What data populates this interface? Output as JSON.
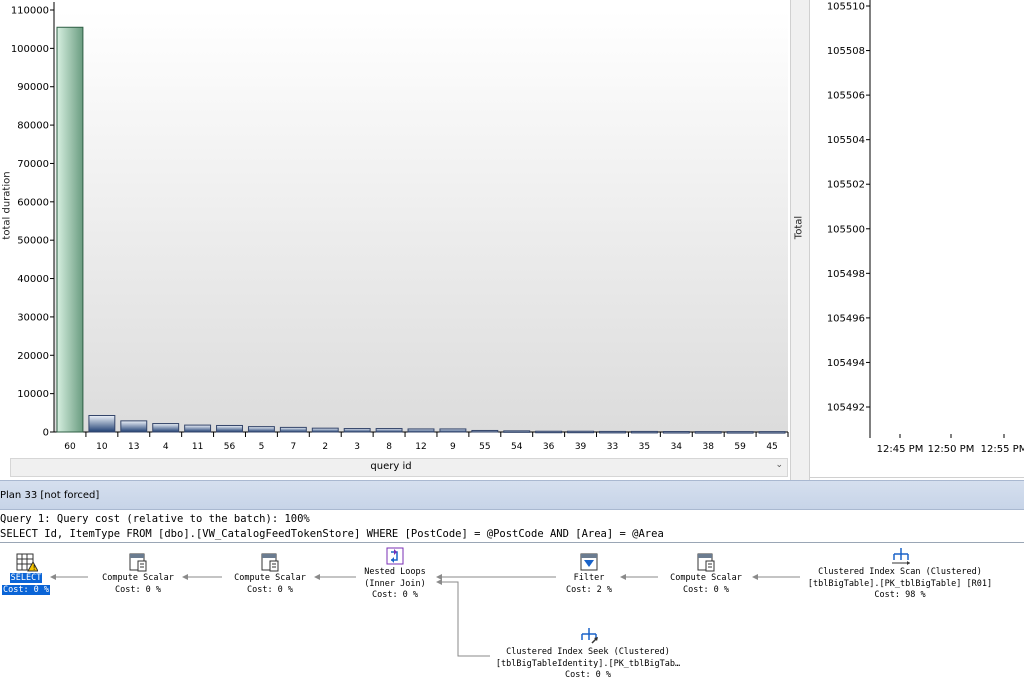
{
  "left_chart": {
    "ylabel": "total duration",
    "xlabel": "query id",
    "y_ticks": [
      "0",
      "10000",
      "20000",
      "30000",
      "40000",
      "50000",
      "60000",
      "70000",
      "80000",
      "90000",
      "100000",
      "110000"
    ]
  },
  "chart_data": [
    {
      "type": "bar",
      "title": "",
      "xlabel": "query id",
      "ylabel": "total duration",
      "ylim": [
        0,
        110000
      ],
      "categories": [
        "60",
        "10",
        "13",
        "4",
        "11",
        "56",
        "5",
        "7",
        "2",
        "3",
        "8",
        "12",
        "9",
        "55",
        "54",
        "36",
        "39",
        "33",
        "35",
        "34",
        "38",
        "59",
        "45"
      ],
      "values": [
        105500,
        4300,
        2900,
        2200,
        1800,
        1700,
        1400,
        1200,
        1000,
        900,
        900,
        800,
        800,
        400,
        300,
        200,
        200,
        150,
        150,
        120,
        100,
        100,
        100
      ],
      "selected_index": 0
    },
    {
      "type": "scatter",
      "ylabel": "Total",
      "y_ticks": [
        "105492",
        "105494",
        "105496",
        "105498",
        "105500",
        "105502",
        "105504",
        "105506",
        "105508",
        "105510"
      ],
      "x_ticks": [
        "12:45 PM",
        "12:50 PM",
        "12:55 PM"
      ]
    }
  ],
  "right_chart": {
    "ylabel": "Total"
  },
  "plan_header": {
    "title": "Plan 33 [not forced]"
  },
  "query": {
    "line1": "Query 1: Query cost (relative to the batch): 100%",
    "line2": "SELECT Id, ItemType FROM [dbo].[VW_CatalogFeedTokenStore] WHERE [PostCode] = @PostCode AND [Area] = @Area"
  },
  "plan_ops": {
    "select": {
      "name": "SELECT",
      "cost": "Cost: 0 %"
    },
    "compute1": {
      "name": "Compute Scalar",
      "cost": "Cost: 0 %"
    },
    "compute2": {
      "name": "Compute Scalar",
      "cost": "Cost: 0 %"
    },
    "nested": {
      "name": "Nested Loops",
      "sub": "(Inner Join)",
      "cost": "Cost: 0 %"
    },
    "filter": {
      "name": "Filter",
      "cost": "Cost: 2 %"
    },
    "compute3": {
      "name": "Compute Scalar",
      "cost": "Cost: 0 %"
    },
    "scan": {
      "name": "Clustered Index Scan (Clustered)",
      "sub": "[tblBigTable].[PK_tblBigTable] [R01]",
      "cost": "Cost: 98 %"
    },
    "seek": {
      "name": "Clustered Index Seek (Clustered)",
      "sub": "[tblBigTableIdentity].[PK_tblBigTab…",
      "cost": "Cost: 0 %"
    }
  },
  "colors": {
    "selected_bar": "#86b8a0",
    "bar": "#c6d6e8",
    "plan_header_bg": "#cfdaec",
    "selection": "#0a64d6"
  }
}
